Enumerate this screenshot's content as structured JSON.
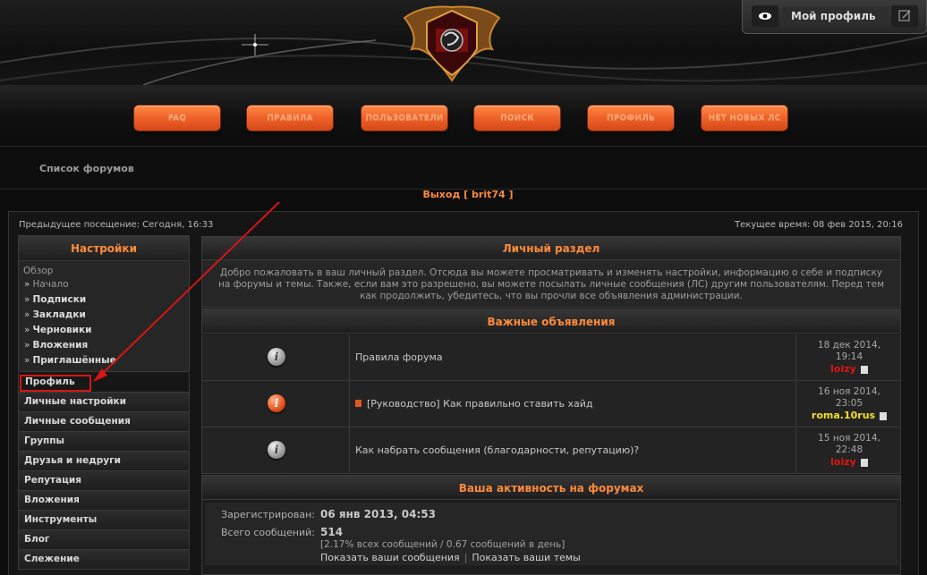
{
  "header": {
    "nav": [
      "FAQ",
      "правила",
      "Пользователи",
      "Поиск",
      "Профиль",
      "Нет новых ЛС"
    ],
    "profile_label": "Мой профиль",
    "icons": {
      "view": "eye-icon",
      "edit": "edit-icon",
      "emblem": "dragon-shield-emblem"
    }
  },
  "breadcrumb": "Список форумов",
  "logout": "Выход [ brit74 ]",
  "visit_info": {
    "prev": "Предыдущее посещение: Сегодня, 16:33",
    "current": "Текущее время: 08 фев 2015, 20:16"
  },
  "sidebar": {
    "title": "Настройки",
    "overview": "Обзор",
    "sub": [
      "Начало",
      "Подписки",
      "Закладки",
      "Черновики",
      "Вложения",
      "Приглашённые"
    ],
    "items": [
      "Профиль",
      "Личные настройки",
      "Личные сообщения",
      "Группы",
      "Друзья и недруги",
      "Репутация",
      "Вложения",
      "Инструменты",
      "Блог",
      "Слежение"
    ]
  },
  "main": {
    "title": "Личный раздел",
    "welcome": "Добро пожаловать в ваш личный раздел. Отсюда вы можете просматривать и изменять настройки, информацию о себе и подписку на форумы и темы. Также, если вам это разрешено, вы можете посылать личные сообщения (ЛС) другим пользователям. Перед тем как продолжить, убедитесь, что вы прочли все объявления администрации.",
    "announcements_title": "Важные объявления",
    "announcements": [
      {
        "title": "Правила форума",
        "date1": "18 дек 2014,",
        "date2": "19:14",
        "user": "loizy",
        "user_color": "#e01414",
        "icon": "grey",
        "tag": false
      },
      {
        "title": "[Руководство] Как правильно ставить хайд",
        "date1": "16 ноя 2014,",
        "date2": "23:05",
        "user": "roma.10rus",
        "user_color": "#f0e020",
        "icon": "orange",
        "tag": true
      },
      {
        "title": "Как набрать сообщения (благодарности, репутацию)?",
        "date1": "15 ноя 2014,",
        "date2": "22:48",
        "user": "loizy",
        "user_color": "#e01414",
        "icon": "grey",
        "tag": false
      }
    ],
    "activity_title": "Ваша активность на форумах",
    "registered_label": "Зарегистрирован:",
    "registered_value": "06 янв 2013, 04:53",
    "posts_label": "Всего сообщений:",
    "posts_value": "514",
    "posts_detail": "[2.17% всех сообщений / 0.67 сообщений в день]",
    "link_posts": "Показать ваши сообщения",
    "link_topics": "Показать ваши темы"
  }
}
